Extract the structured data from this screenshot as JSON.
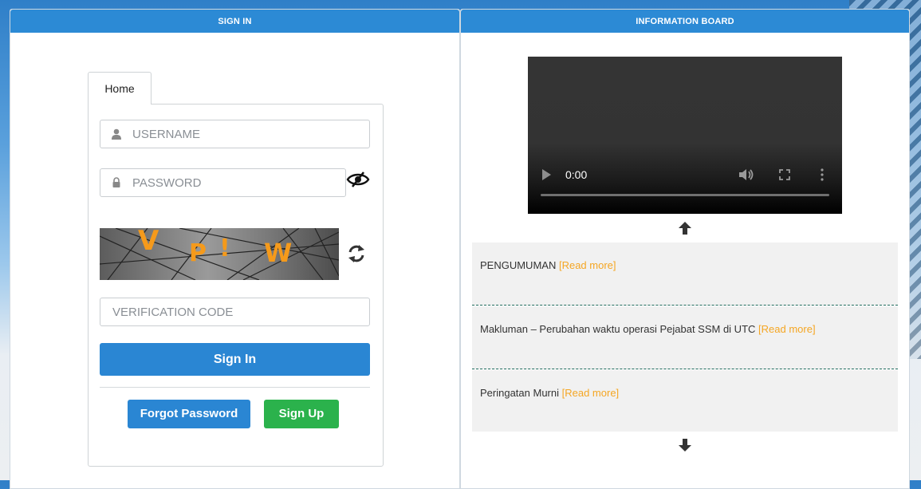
{
  "signin": {
    "header": "SIGN IN",
    "tab_label": "Home",
    "username_placeholder": "USERNAME",
    "password_placeholder": "PASSWORD",
    "captcha_chars": [
      "V",
      "P",
      "!",
      "W"
    ],
    "verification_placeholder": "VERIFICATION CODE",
    "signin_label": "Sign In",
    "forgot_label": "Forgot Password",
    "signup_label": "Sign Up",
    "colors": {
      "primary": "#2a86d3",
      "success": "#2bb24c",
      "captcha_text": "#f59a1b"
    }
  },
  "info": {
    "header": "INFORMATION BOARD",
    "video": {
      "time": "0:00"
    },
    "read_more": "[Read more]",
    "items": [
      {
        "title": "PENGUMUMAN"
      },
      {
        "title": "Makluman – Perubahan waktu operasi Pejabat SSM di UTC"
      },
      {
        "title": "Peringatan Murni"
      }
    ],
    "colors": {
      "header": "#2c8ad5",
      "read_more": "#f5a623"
    }
  }
}
